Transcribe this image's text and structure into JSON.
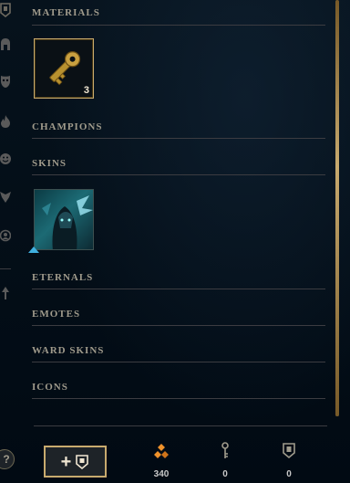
{
  "sections": {
    "materials": "MATERIALS",
    "champions": "CHAMPIONS",
    "skins": "SKINS",
    "eternals": "ETERNALS",
    "emotes": "EMOTES",
    "ward_skins": "WARD SKINS",
    "icons": "ICONS"
  },
  "materials": {
    "key_fragment_count": "3"
  },
  "footer": {
    "add_button_symbol": "+",
    "currencies": [
      {
        "icon": "orange-essence-icon",
        "value": "340"
      },
      {
        "icon": "key-icon",
        "value": "0"
      },
      {
        "icon": "chest-icon",
        "value": "0"
      }
    ]
  },
  "help": "?",
  "sidebar_icons": [
    "chest-filter-icon",
    "champion-helmet-icon",
    "skin-mask-icon",
    "eternals-flame-icon",
    "emote-face-icon",
    "ward-icon",
    "summoner-icon-face-icon",
    "crafting-arrow-icon"
  ],
  "colors": {
    "gold": "#c8aa6e",
    "background": "#010a13",
    "text": "#a09b8c"
  }
}
